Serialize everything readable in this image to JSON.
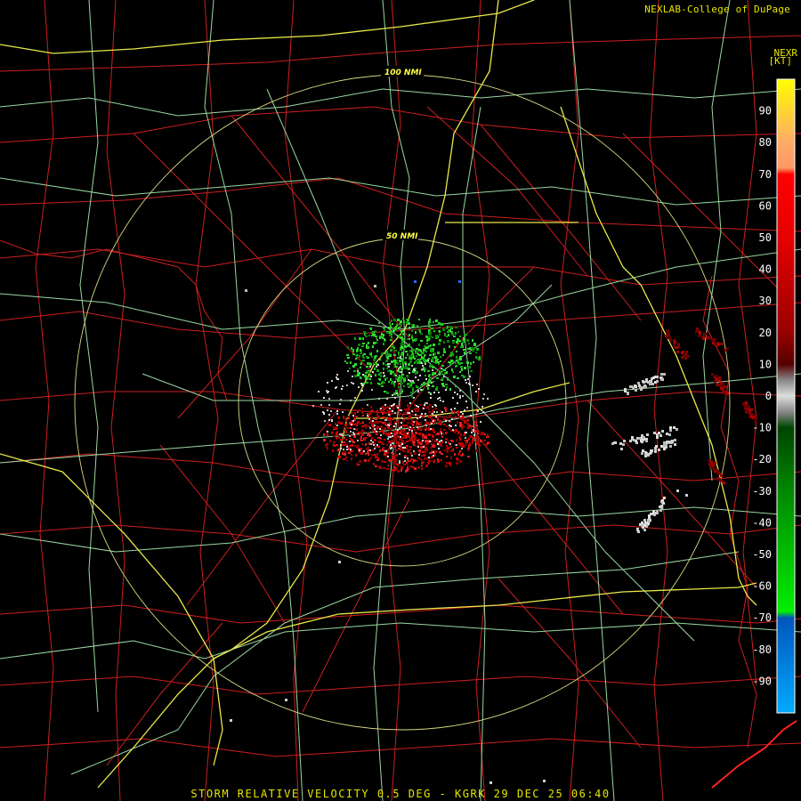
{
  "header": {
    "credit": "NEXLAB-College of DuPage",
    "product_code": "NEXR",
    "units": "[KT]"
  },
  "footer": {
    "caption": "STORM RELATIVE VELOCITY 0.5 DEG - KGRK 29 DEC 25 06:40"
  },
  "range_rings": [
    {
      "label": "100 NMI"
    },
    {
      "label": "50 NMI"
    }
  ],
  "legend": {
    "ticks": [
      "90",
      "80",
      "70",
      "60",
      "50",
      "40",
      "30",
      "20",
      "10",
      "0",
      "-10",
      "-20",
      "-30",
      "-40",
      "-50",
      "-60",
      "-70",
      "-80",
      "-90"
    ],
    "color_stops": [
      {
        "value": 100,
        "color": "#ffff00"
      },
      {
        "value": 80,
        "color": "#ffaa66"
      },
      {
        "value": 72,
        "color": "#ff9966"
      },
      {
        "value": 70,
        "color": "#ff0000"
      },
      {
        "value": 50,
        "color": "#e60000"
      },
      {
        "value": 20,
        "color": "#990000"
      },
      {
        "value": 10,
        "color": "#550000"
      },
      {
        "value": 5,
        "color": "#888888"
      },
      {
        "value": 0,
        "color": "#dddddd"
      },
      {
        "value": -5,
        "color": "#888888"
      },
      {
        "value": -10,
        "color": "#004400"
      },
      {
        "value": -30,
        "color": "#008800"
      },
      {
        "value": -68,
        "color": "#00ee00"
      },
      {
        "value": -70,
        "color": "#0055bb"
      },
      {
        "value": -100,
        "color": "#00aaff"
      }
    ]
  },
  "colors": {
    "county_lines": "#cc1f1f",
    "highways": "#9ad7a0",
    "interstates": "#e8e84a",
    "range_rings": "#d8d880",
    "inbound": "#22cc22",
    "outbound": "#cc0000",
    "near_zero": "#d0d0d0"
  }
}
